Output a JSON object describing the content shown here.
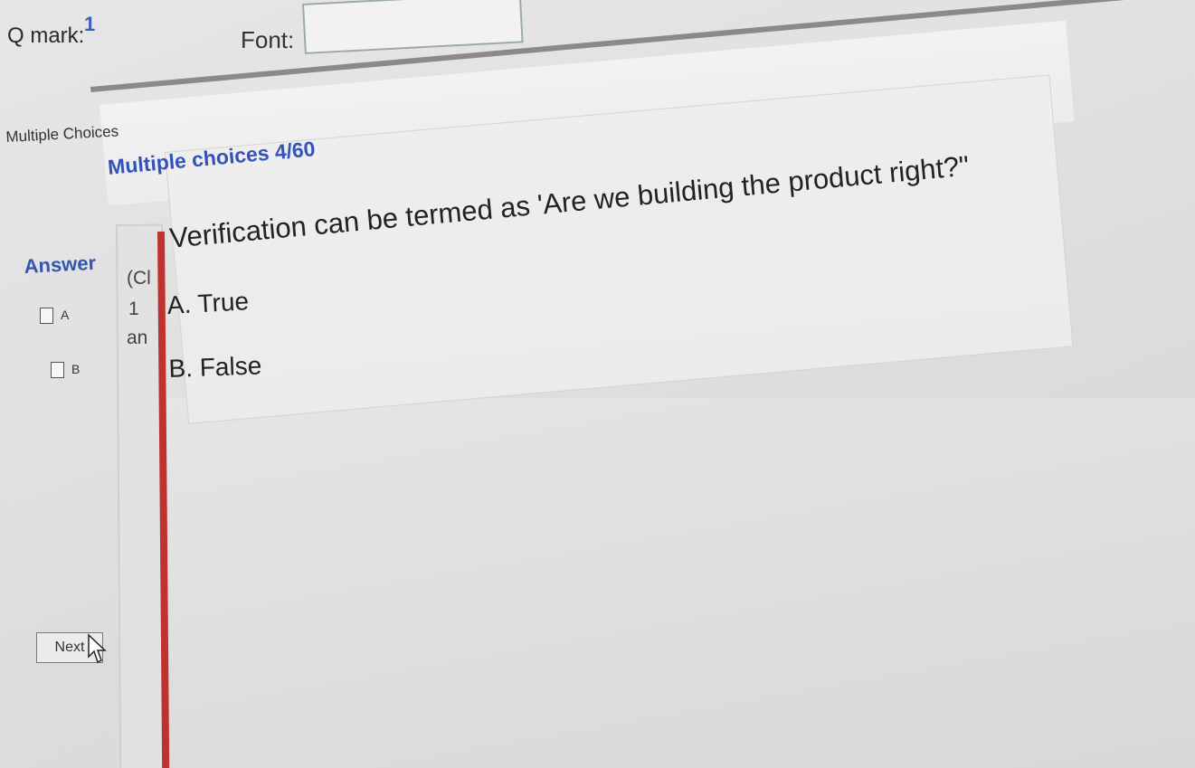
{
  "top_bar": {
    "qmark_label": "Q mark:",
    "qmark_value": "1",
    "font_label": "Font:"
  },
  "section": {
    "title": "Multiple Choices"
  },
  "answer_panel": {
    "label": "Answer",
    "options": [
      {
        "letter": "A"
      },
      {
        "letter": "B"
      }
    ],
    "next_label": "Next"
  },
  "side_column": {
    "text_1": "(Cl",
    "text_2": "1",
    "text_3": "an"
  },
  "question": {
    "heading": "Multiple choices 4/60",
    "text": "Verification can be termed as 'Are we building the product right?\"",
    "options": [
      {
        "label": "A.  True"
      },
      {
        "label": "B.  False"
      }
    ]
  },
  "colors": {
    "accent_blue": "#3552b8",
    "divider_red": "#c0322d"
  },
  "icons": {
    "checkbox": "empty-square",
    "cursor": "mouse-pointer-icon"
  }
}
